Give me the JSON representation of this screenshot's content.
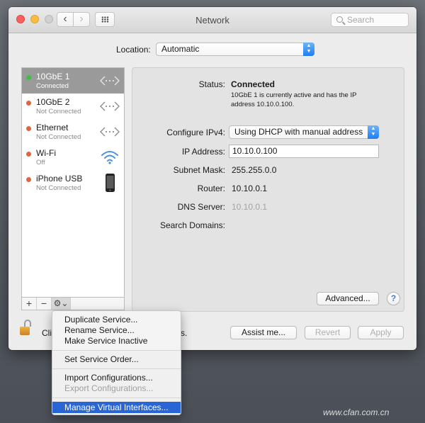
{
  "window": {
    "title": "Network",
    "search_placeholder": "Search",
    "back_glyph": "‹",
    "forward_glyph": "›"
  },
  "location": {
    "label": "Location:",
    "value": "Automatic"
  },
  "services": [
    {
      "name": "10GbE 1",
      "status": "Connected",
      "dot": "green",
      "icon": "ethernet-arrows-icon",
      "selected": true
    },
    {
      "name": "10GbE 2",
      "status": "Not Connected",
      "dot": "red",
      "icon": "ethernet-arrows-icon",
      "selected": false
    },
    {
      "name": "Ethernet",
      "status": "Not Connected",
      "dot": "red",
      "icon": "ethernet-arrows-icon",
      "selected": false
    },
    {
      "name": "Wi-Fi",
      "status": "Off",
      "dot": "red",
      "icon": "wifi-icon",
      "selected": false
    },
    {
      "name": "iPhone USB",
      "status": "Not Connected",
      "dot": "red",
      "icon": "iphone-icon",
      "selected": false
    }
  ],
  "sidebar_controls": {
    "plus": "+",
    "minus": "−",
    "gear": "⚙⌄"
  },
  "detail": {
    "status_label": "Status:",
    "status_value": "Connected",
    "status_desc_1": "10GbE 1 is currently active and has the IP",
    "status_desc_2": "address 10.10.0.100.",
    "configure_label": "Configure IPv4:",
    "configure_value": "Using DHCP with manual address",
    "ip_label": "IP Address:",
    "ip_value": "10.10.0.100",
    "subnet_label": "Subnet Mask:",
    "subnet_value": "255.255.0.0",
    "router_label": "Router:",
    "router_value": "10.10.0.1",
    "dns_label": "DNS Server:",
    "dns_value": "10.10.0.1",
    "search_domains_label": "Search Domains:",
    "advanced_button": "Advanced...",
    "help_button": "?"
  },
  "footer": {
    "lock_text_left": "Cli",
    "lock_text_right": "s.",
    "assist_button": "Assist me...",
    "revert_button": "Revert",
    "apply_button": "Apply"
  },
  "gear_menu": {
    "items": [
      {
        "label": "Duplicate Service...",
        "enabled": true
      },
      {
        "label": "Rename Service...",
        "enabled": true
      },
      {
        "label": "Make Service Inactive",
        "enabled": true
      },
      {
        "label": "Set Service Order...",
        "enabled": true
      },
      {
        "label": "Import Configurations...",
        "enabled": true
      },
      {
        "label": "Export Configurations...",
        "enabled": false
      },
      {
        "label": "Manage Virtual Interfaces...",
        "enabled": true,
        "highlighted": true
      }
    ]
  },
  "watermark": "www.cfan.com.cn",
  "colors": {
    "connected": "#3ec13e",
    "not_connected": "#e0643c",
    "highlight": "#2a65d6"
  }
}
